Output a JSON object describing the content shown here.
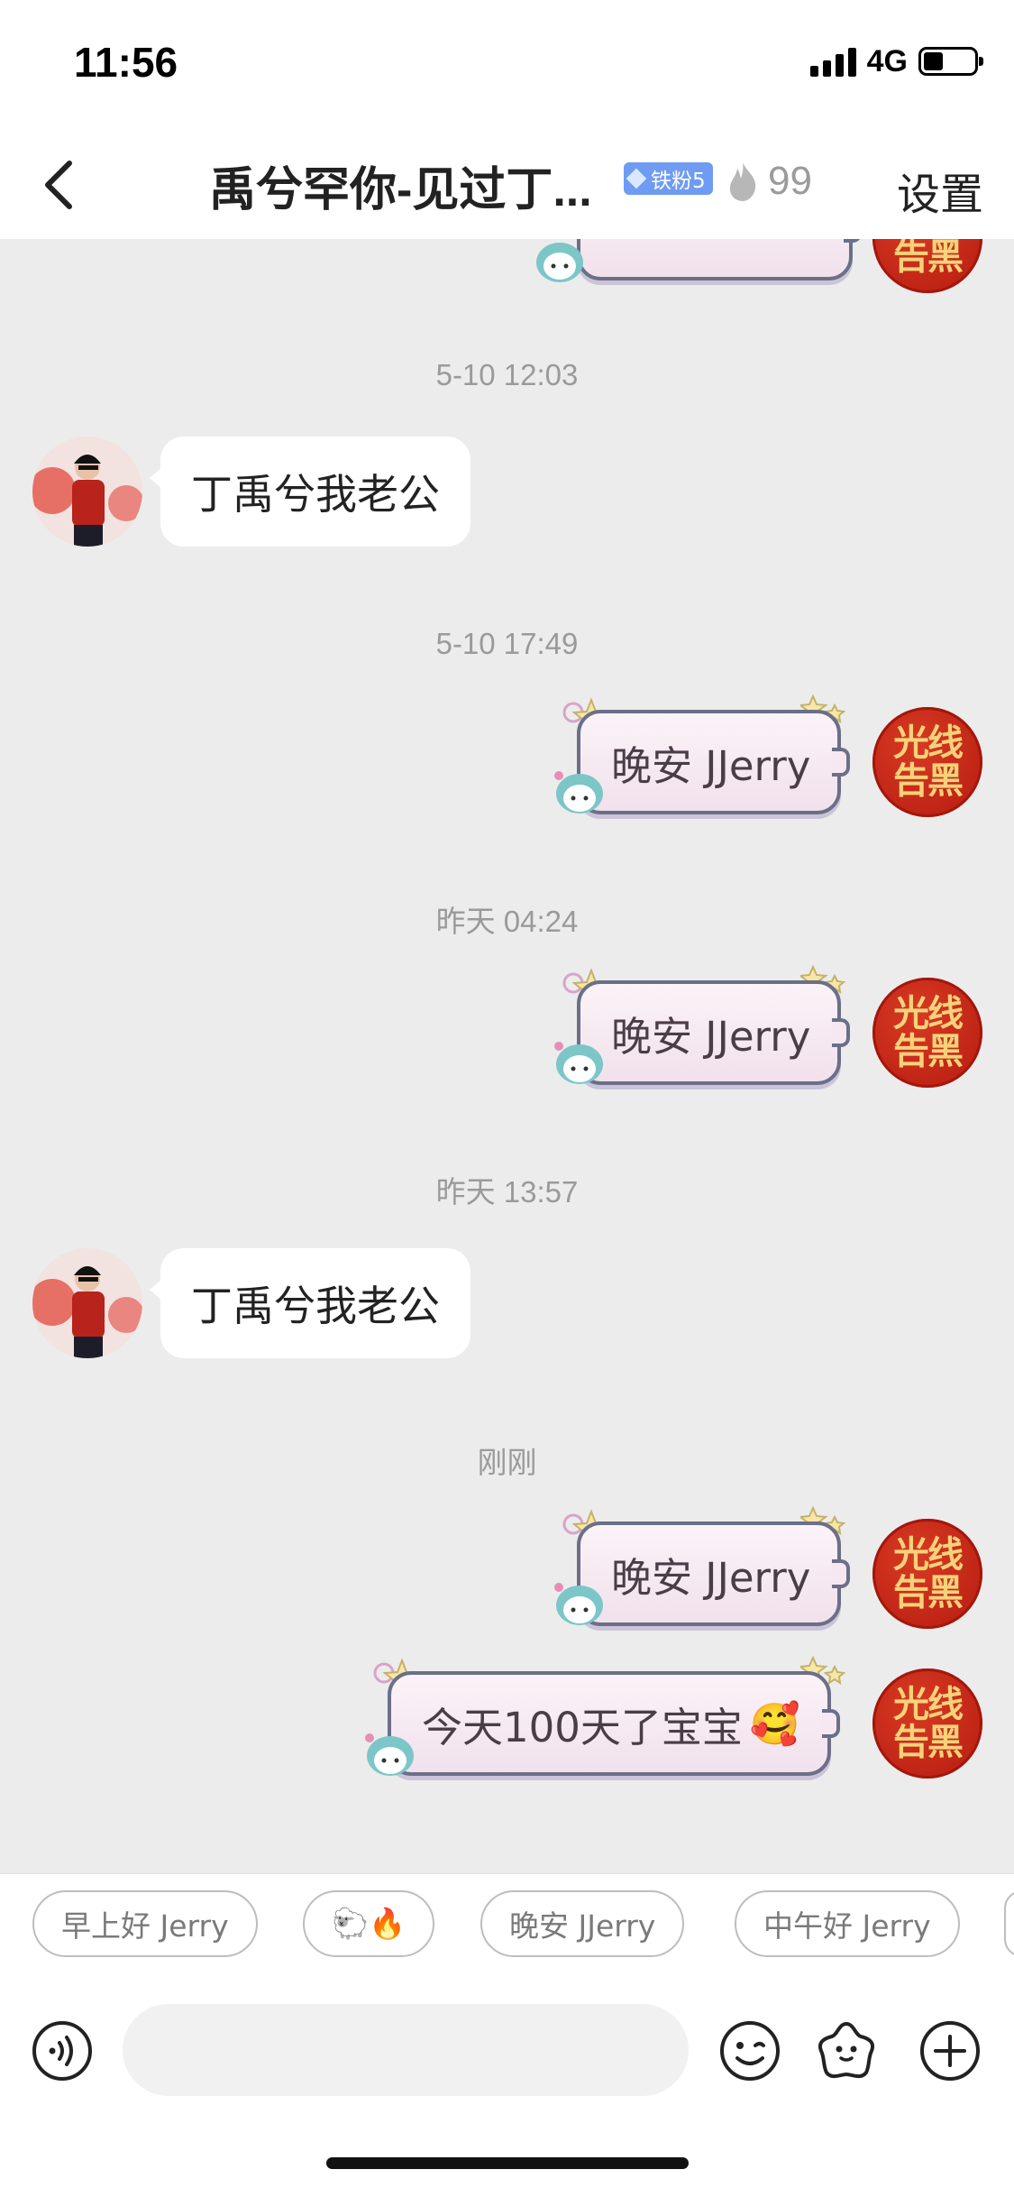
{
  "status_bar": {
    "time": "11:56",
    "network": "4G",
    "battery_level": 0.38
  },
  "header": {
    "title": "禹兮罕你-见过丁...",
    "fan_badge": "铁粉5",
    "flame_count": "99",
    "settings_label": "设置"
  },
  "messages": {
    "ts1": "5-10 12:03",
    "m1": "丁禹兮我老公",
    "ts2": "5-10 17:49",
    "m2": "晚安 JJerry",
    "ts3": "昨天 04:24",
    "m3": "晚安 JJerry",
    "ts4": "昨天 13:57",
    "m4": "丁禹兮我老公",
    "ts5": "刚刚",
    "m5": "晚安 JJerry",
    "m6": "今天100天了宝宝",
    "m6_emoji": "🥰"
  },
  "my_avatar_text": "光线告黑",
  "quick_replies": [
    "早上好 Jerry",
    "🐑🔥",
    "晚安 JJerry",
    "中午好 Jerry"
  ],
  "input": {
    "placeholder": ""
  },
  "colors": {
    "background": "#ececec",
    "fan_badge": "#6f9bf2",
    "my_avatar": "#c1251a",
    "bubble_border": "#6b6f88"
  }
}
